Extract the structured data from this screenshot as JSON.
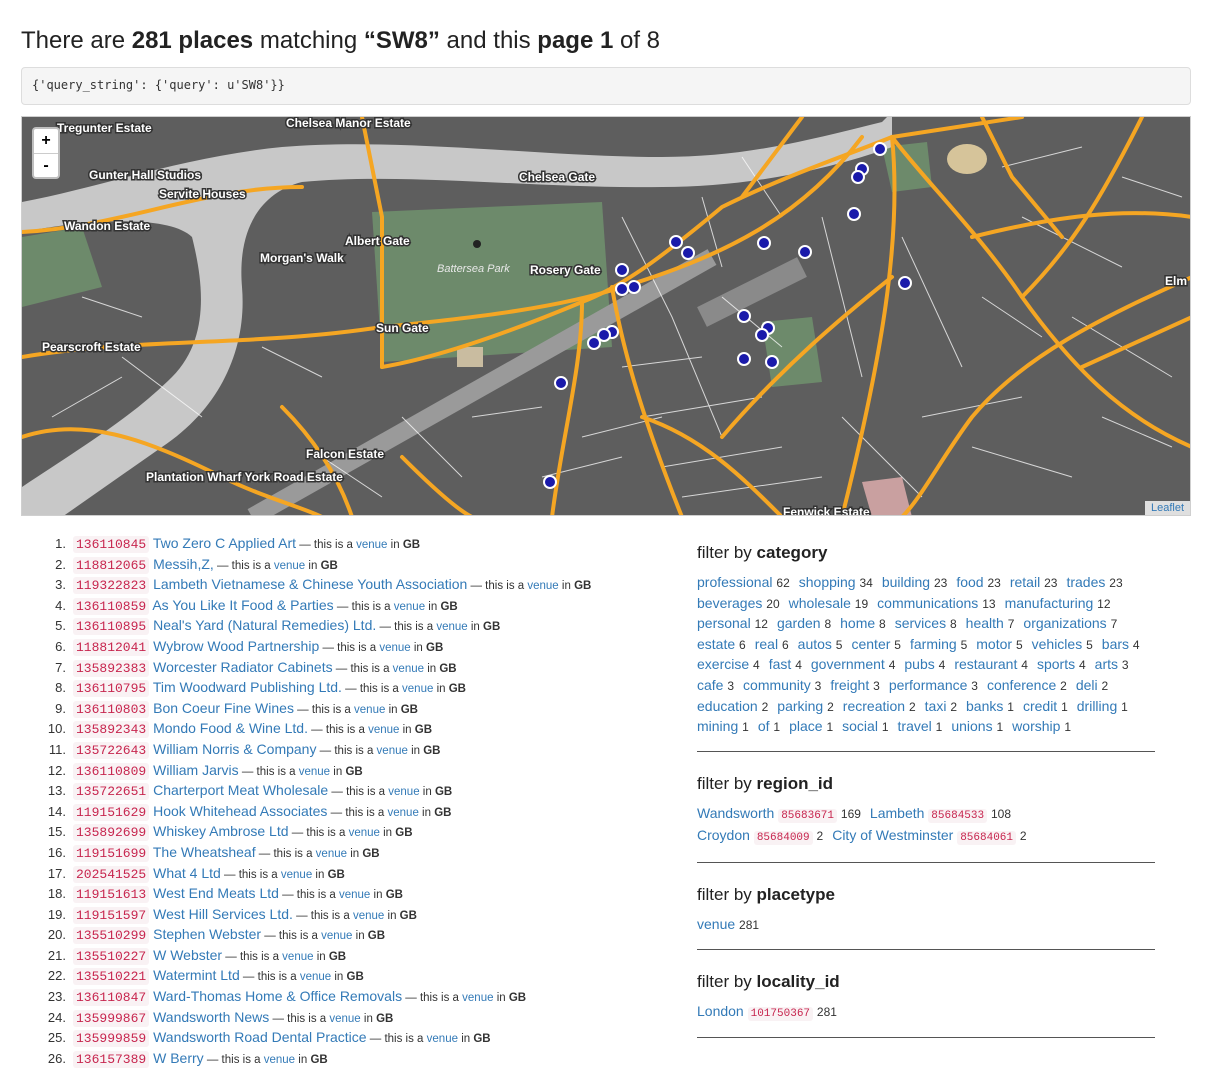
{
  "header": {
    "pre": "There are ",
    "count": "281 places",
    "mid": " matching ",
    "query": "“SW8”",
    "mid2": " and this ",
    "page": "page 1",
    "post": " of 8"
  },
  "query_box": "{'query_string': {'query': u'SW8'}}",
  "map": {
    "zoom_in": "+",
    "zoom_out": "-",
    "attribution": "Leaflet",
    "park_label": "Battersea Park",
    "labels": [
      "Tregunter Estate",
      "Chelsea Manor Estate",
      "Gunter Hall Studios",
      "Servite Houses",
      "Chelsea Gate",
      "Wandon Estate",
      "Albert Gate",
      "Morgan's Walk",
      "Rosery Gate",
      "Elm",
      "Sun Gate",
      "Pearscroft Estate",
      "Falcon Estate",
      "Plantation Wharf York Road Estate",
      "Fenwick Estate"
    ]
  },
  "results": [
    {
      "n": "1.",
      "id": "136110845",
      "name": "Two Zero C Applied Art"
    },
    {
      "n": "2.",
      "id": "118812065",
      "name": "Messih,Z,"
    },
    {
      "n": "3.",
      "id": "119322823",
      "name": "Lambeth Vietnamese & Chinese Youth Association"
    },
    {
      "n": "4.",
      "id": "136110859",
      "name": "As You Like It Food & Parties"
    },
    {
      "n": "5.",
      "id": "136110895",
      "name": "Neal's Yard (Natural Remedies) Ltd."
    },
    {
      "n": "6.",
      "id": "118812041",
      "name": "Wybrow Wood Partnership"
    },
    {
      "n": "7.",
      "id": "135892383",
      "name": "Worcester Radiator Cabinets"
    },
    {
      "n": "8.",
      "id": "136110795",
      "name": "Tim Woodward Publishing Ltd."
    },
    {
      "n": "9.",
      "id": "136110803",
      "name": "Bon Coeur Fine Wines"
    },
    {
      "n": "10.",
      "id": "135892343",
      "name": "Mondo Food & Wine Ltd."
    },
    {
      "n": "11.",
      "id": "135722643",
      "name": "William Norris & Company"
    },
    {
      "n": "12.",
      "id": "136110809",
      "name": "William Jarvis"
    },
    {
      "n": "13.",
      "id": "135722651",
      "name": "Charterport Meat Wholesale"
    },
    {
      "n": "14.",
      "id": "119151629",
      "name": "Hook Whitehead Associates"
    },
    {
      "n": "15.",
      "id": "135892699",
      "name": "Whiskey Ambrose Ltd"
    },
    {
      "n": "16.",
      "id": "119151699",
      "name": "The Wheatsheaf"
    },
    {
      "n": "17.",
      "id": "202541525",
      "name": "What 4 Ltd"
    },
    {
      "n": "18.",
      "id": "119151613",
      "name": "West End Meats Ltd"
    },
    {
      "n": "19.",
      "id": "119151597",
      "name": "West Hill Services Ltd."
    },
    {
      "n": "20.",
      "id": "135510299",
      "name": "Stephen Webster"
    },
    {
      "n": "21.",
      "id": "135510227",
      "name": "W Webster"
    },
    {
      "n": "22.",
      "id": "135510221",
      "name": "Watermint Ltd"
    },
    {
      "n": "23.",
      "id": "136110847",
      "name": "Ward-Thomas Home & Office Removals"
    },
    {
      "n": "24.",
      "id": "135999867",
      "name": "Wandsworth News"
    },
    {
      "n": "25.",
      "id": "135999859",
      "name": "Wandsworth Road Dental Practice"
    },
    {
      "n": "26.",
      "id": "136157389",
      "name": "W Berry"
    }
  ],
  "result_text": {
    "sep": " — this is a ",
    "type": "venue",
    "in": " in ",
    "country": "GB"
  },
  "filters": {
    "prefix": "filter by ",
    "category": {
      "title": "category",
      "items": [
        {
          "label": "professional",
          "count": "62"
        },
        {
          "label": "shopping",
          "count": "34"
        },
        {
          "label": "building",
          "count": "23"
        },
        {
          "label": "food",
          "count": "23"
        },
        {
          "label": "retail",
          "count": "23"
        },
        {
          "label": "trades",
          "count": "23"
        },
        {
          "label": "beverages",
          "count": "20"
        },
        {
          "label": "wholesale",
          "count": "19"
        },
        {
          "label": "communications",
          "count": "13"
        },
        {
          "label": "manufacturing",
          "count": "12"
        },
        {
          "label": "personal",
          "count": "12"
        },
        {
          "label": "garden",
          "count": "8"
        },
        {
          "label": "home",
          "count": "8"
        },
        {
          "label": "services",
          "count": "8"
        },
        {
          "label": "health",
          "count": "7"
        },
        {
          "label": "organizations",
          "count": "7"
        },
        {
          "label": "estate",
          "count": "6"
        },
        {
          "label": "real",
          "count": "6"
        },
        {
          "label": "autos",
          "count": "5"
        },
        {
          "label": "center",
          "count": "5"
        },
        {
          "label": "farming",
          "count": "5"
        },
        {
          "label": "motor",
          "count": "5"
        },
        {
          "label": "vehicles",
          "count": "5"
        },
        {
          "label": "bars",
          "count": "4"
        },
        {
          "label": "exercise",
          "count": "4"
        },
        {
          "label": "fast",
          "count": "4"
        },
        {
          "label": "government",
          "count": "4"
        },
        {
          "label": "pubs",
          "count": "4"
        },
        {
          "label": "restaurant",
          "count": "4"
        },
        {
          "label": "sports",
          "count": "4"
        },
        {
          "label": "arts",
          "count": "3"
        },
        {
          "label": "cafe",
          "count": "3"
        },
        {
          "label": "community",
          "count": "3"
        },
        {
          "label": "freight",
          "count": "3"
        },
        {
          "label": "performance",
          "count": "3"
        },
        {
          "label": "conference",
          "count": "2"
        },
        {
          "label": "deli",
          "count": "2"
        },
        {
          "label": "education",
          "count": "2"
        },
        {
          "label": "parking",
          "count": "2"
        },
        {
          "label": "recreation",
          "count": "2"
        },
        {
          "label": "taxi",
          "count": "2"
        },
        {
          "label": "banks",
          "count": "1"
        },
        {
          "label": "credit",
          "count": "1"
        },
        {
          "label": "drilling",
          "count": "1"
        },
        {
          "label": "mining",
          "count": "1"
        },
        {
          "label": "of",
          "count": "1"
        },
        {
          "label": "place",
          "count": "1"
        },
        {
          "label": "social",
          "count": "1"
        },
        {
          "label": "travel",
          "count": "1"
        },
        {
          "label": "unions",
          "count": "1"
        },
        {
          "label": "worship",
          "count": "1"
        }
      ]
    },
    "region": {
      "title": "region_id",
      "items": [
        {
          "label": "Wandsworth",
          "id": "85683671",
          "count": "169"
        },
        {
          "label": "Lambeth",
          "id": "85684533",
          "count": "108"
        },
        {
          "label": "Croydon",
          "id": "85684009",
          "count": "2"
        },
        {
          "label": "City of Westminster",
          "id": "85684061",
          "count": "2"
        }
      ]
    },
    "placetype": {
      "title": "placetype",
      "items": [
        {
          "label": "venue",
          "count": "281"
        }
      ]
    },
    "locality": {
      "title": "locality_id",
      "items": [
        {
          "label": "London",
          "id": "101750367",
          "count": "281"
        }
      ]
    }
  }
}
